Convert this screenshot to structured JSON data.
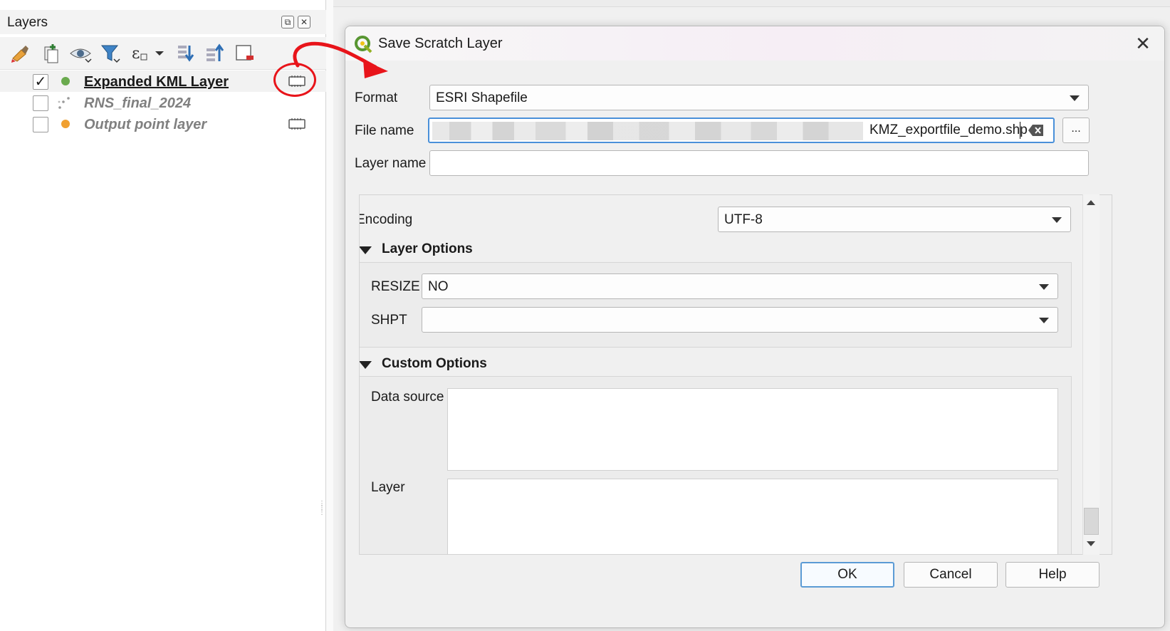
{
  "layers_panel": {
    "title": "Layers",
    "toolbar": [
      {
        "icon": "style-paint-icon"
      },
      {
        "icon": "add-group-icon"
      },
      {
        "icon": "visibility-eye-icon"
      },
      {
        "icon": "filter-icon"
      },
      {
        "icon": "expression-filter-icon"
      },
      {
        "icon": "expand-all-icon"
      },
      {
        "icon": "collapse-all-icon"
      },
      {
        "icon": "remove-layer-icon"
      }
    ],
    "layers": [
      {
        "name": "Expanded KML Layer",
        "checked": true,
        "symbol": "point-green",
        "active": true,
        "scratch": true
      },
      {
        "name": "RNS_final_2024",
        "checked": false,
        "symbol": "point-scatter",
        "active": false,
        "scratch": false
      },
      {
        "name": "Output point layer",
        "checked": false,
        "symbol": "point-orange",
        "active": false,
        "scratch": true
      }
    ]
  },
  "dialog": {
    "title": "Save Scratch Layer",
    "format": {
      "label": "Format",
      "value": "ESRI Shapefile"
    },
    "file_name": {
      "label": "File name",
      "visible_value": "KMZ_exportfile_demo.shp",
      "browse_label": "..."
    },
    "layer_name": {
      "label": "Layer name",
      "value": ""
    },
    "encoding": {
      "label": "Encoding",
      "value": "UTF-8"
    },
    "layer_options": {
      "header": "Layer Options",
      "resize": {
        "label": "RESIZE",
        "value": "NO"
      },
      "shpt": {
        "label": "SHPT",
        "value": ""
      }
    },
    "custom_options": {
      "header": "Custom Options",
      "data_source_label": "Data source",
      "layer_label": "Layer"
    },
    "buttons": {
      "ok": "OK",
      "cancel": "Cancel",
      "help": "Help"
    }
  },
  "colors": {
    "annotation_red": "#e8141a",
    "focus_blue": "#4a90d9",
    "green_point": "#6aaa4e",
    "orange_point": "#f0a030"
  }
}
